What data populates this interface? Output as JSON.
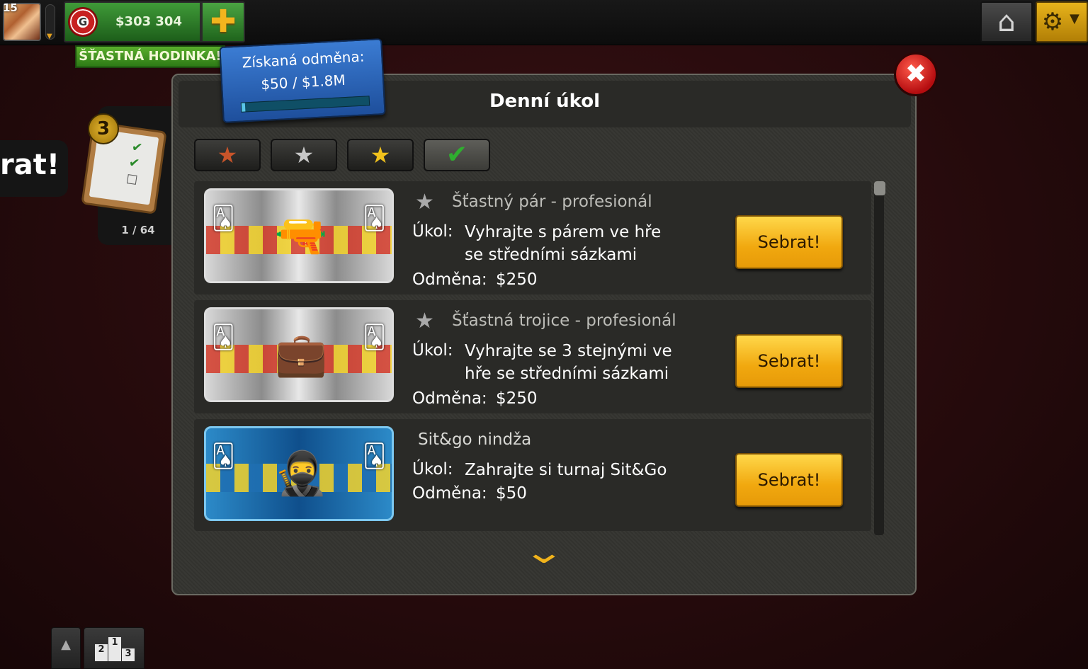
{
  "player": {
    "level": "15",
    "money": "$303 304",
    "lucky_hour": "ŠŤASTNÁ HODINKA!"
  },
  "icons": {
    "chip": "G",
    "plus": "✚",
    "home": "⌂",
    "gear": "⚙",
    "caret": "▼",
    "close": "✖",
    "star": "★",
    "check": "✔",
    "chevron_down": "⌄",
    "up": "▲"
  },
  "background": {
    "bubble_text": "rat!",
    "quest_count": "3",
    "quest_progress": "1 / 64"
  },
  "reward": {
    "label": "Získaná odměna:",
    "value": "$50 / $1.8M",
    "progress": 0.03
  },
  "dialog": {
    "title": "Denní úkol",
    "task_label": "Úkol:",
    "reward_label": "Odměna:",
    "collect_label": "Sebrat!",
    "tabs": [
      {
        "name": "bronze",
        "glyph": "★"
      },
      {
        "name": "silver",
        "glyph": "★"
      },
      {
        "name": "gold",
        "glyph": "★"
      },
      {
        "name": "completed",
        "glyph": "✔"
      }
    ],
    "quests": [
      {
        "title": "Šťastný pár - profesionál",
        "task_line1": "Vyhrajte s párem ve hře",
        "task_line2": "se středními sázkami",
        "reward": "$250"
      },
      {
        "title": "Šťastná trojice - profesionál",
        "task_line1": "Vyhrajte se 3 stejnými ve",
        "task_line2": "hře se středními sázkami",
        "reward": "$250"
      },
      {
        "title": "Sit&go nindža",
        "task_line1": "Zahrajte si turnaj Sit&Go",
        "reward": "$50"
      }
    ]
  },
  "colors": {
    "accent_gold": "#f1b31b",
    "money_green": "#3f9a38",
    "close_red": "#c01214",
    "reward_blue": "#2c67b8"
  }
}
